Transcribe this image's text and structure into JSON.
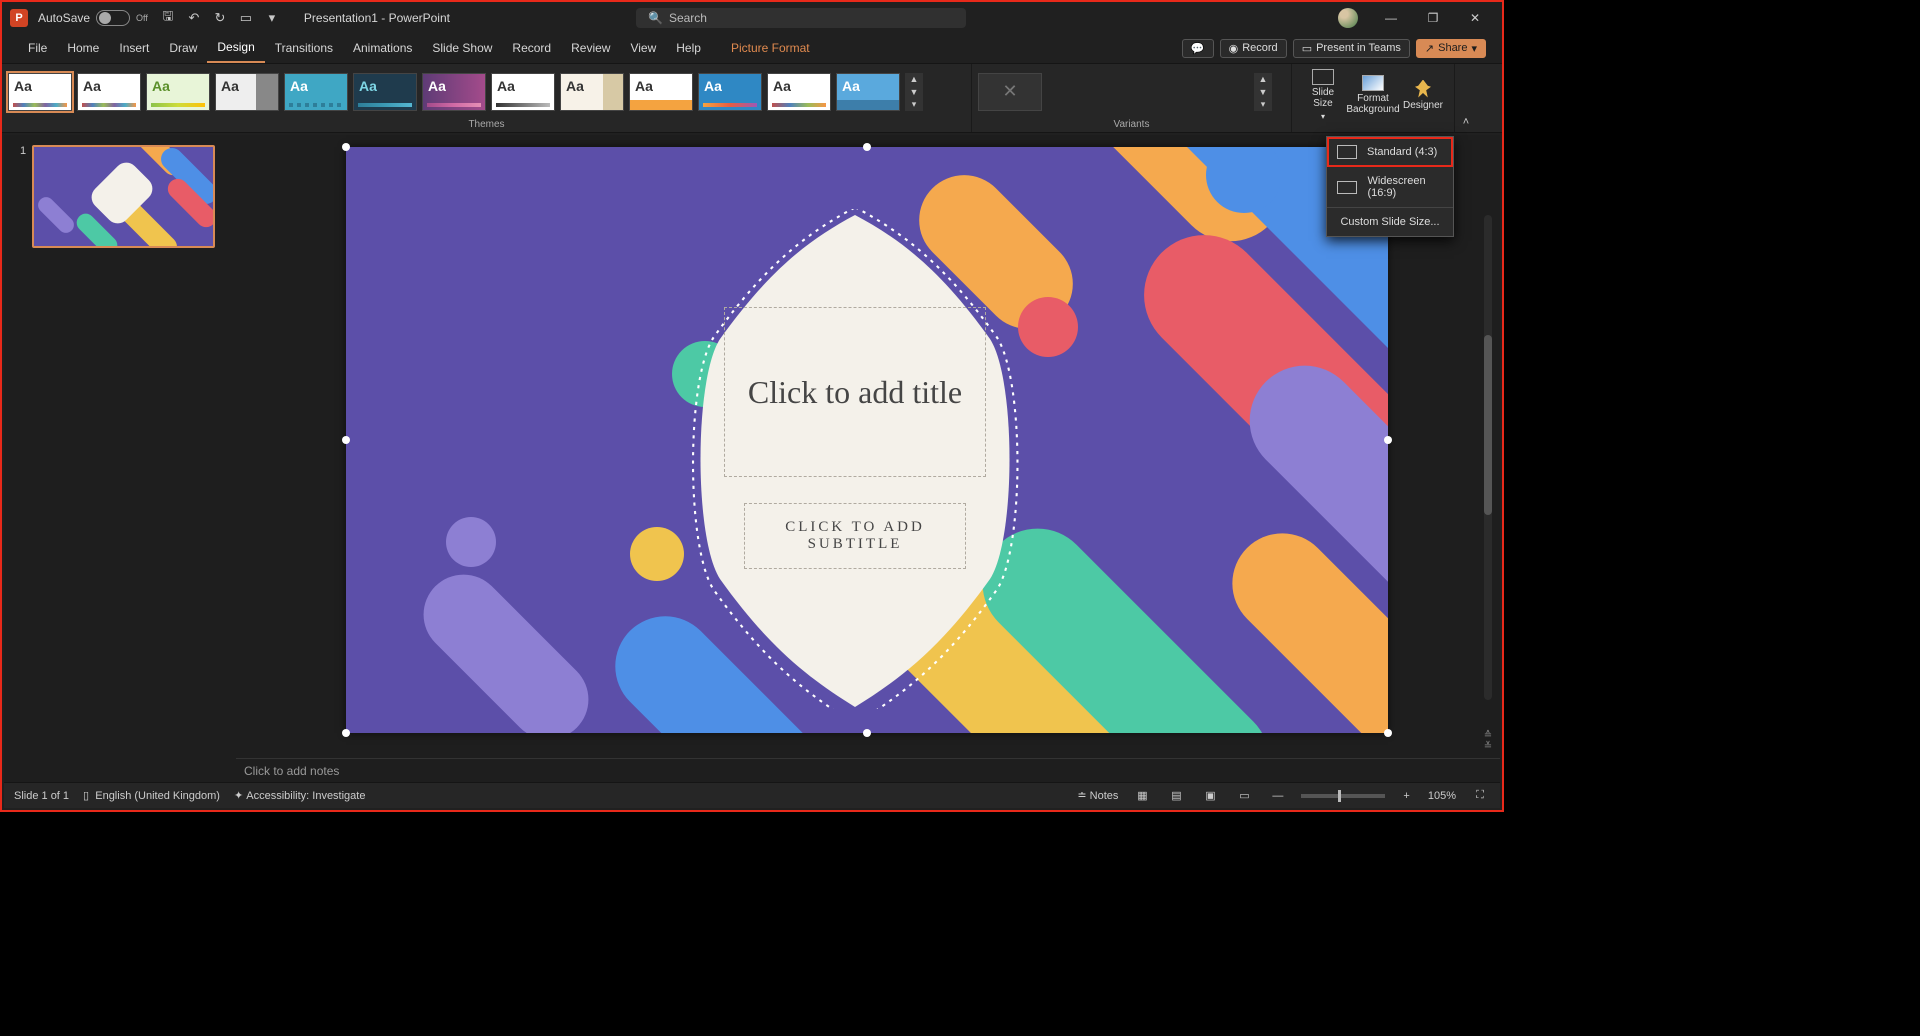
{
  "titlebar": {
    "autosave_label": "AutoSave",
    "autosave_state": "Off",
    "doc_title": "Presentation1 - PowerPoint",
    "search_placeholder": "Search"
  },
  "tabs": {
    "items": [
      "File",
      "Home",
      "Insert",
      "Draw",
      "Design",
      "Transitions",
      "Animations",
      "Slide Show",
      "Record",
      "Review",
      "View",
      "Help"
    ],
    "active": "Design",
    "picture_format": "Picture Format",
    "record_btn": "Record",
    "present_btn": "Present in Teams",
    "share_btn": "Share"
  },
  "ribbon": {
    "themes_label": "Themes",
    "variants_label": "Variants",
    "slide_size": "Slide\nSize",
    "format_bg": "Format\nBackground",
    "designer": "Designer"
  },
  "dropdown": {
    "standard": "Standard (4:3)",
    "widescreen": "Widescreen (16:9)",
    "custom": "Custom Slide Size..."
  },
  "slide": {
    "title_placeholder": "Click to add title",
    "subtitle_placeholder": "CLICK TO ADD SUBTITLE"
  },
  "notes": {
    "placeholder": "Click to add notes"
  },
  "status": {
    "slide_of": "Slide 1 of 1",
    "lang": "English (United Kingdom)",
    "accessibility": "Accessibility: Investigate",
    "notes_btn": "Notes",
    "zoom": "105%"
  },
  "thumb": {
    "index": "1"
  }
}
